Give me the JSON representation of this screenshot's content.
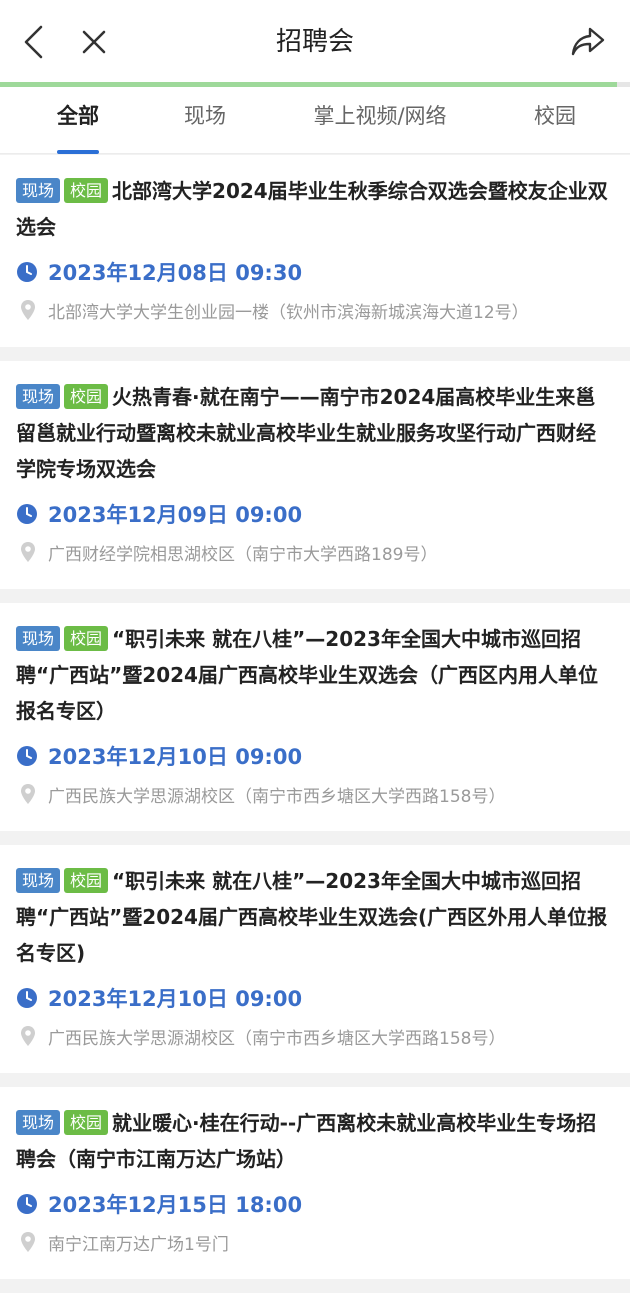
{
  "header": {
    "title": "招聘会"
  },
  "page_load_progress": 0.98,
  "tabs": [
    {
      "label": "全部",
      "active": true
    },
    {
      "label": "现场",
      "active": false
    },
    {
      "label": "掌上视频/网络",
      "active": false
    },
    {
      "label": "校园",
      "active": false
    }
  ],
  "events": [
    {
      "tags": [
        "现场",
        "校园"
      ],
      "title": "北部湾大学2024届毕业生秋季综合双选会暨校友企业双选会",
      "time": "2023年12月08日 09:30",
      "location": "北部湾大学大学生创业园一楼（钦州市滨海新城滨海大道12号）"
    },
    {
      "tags": [
        "现场",
        "校园"
      ],
      "title": "火热青春·就在南宁——南宁市2024届高校毕业生来邕留邕就业行动暨离校未就业高校毕业生就业服务攻坚行动广西财经学院专场双选会",
      "time": "2023年12月09日 09:00",
      "location": "广西财经学院相思湖校区（南宁市大学西路189号）"
    },
    {
      "tags": [
        "现场",
        "校园"
      ],
      "title": "“职引未来 就在八桂”—2023年全国大中城市巡回招聘“广西站”暨2024届广西高校毕业生双选会（广西区内用人单位报名专区）",
      "time": "2023年12月10日 09:00",
      "location": "广西民族大学思源湖校区（南宁市西乡塘区大学西路158号）"
    },
    {
      "tags": [
        "现场",
        "校园"
      ],
      "title": "“职引未来 就在八桂”—2023年全国大中城市巡回招聘“广西站”暨2024届广西高校毕业生双选会(广西区外用人单位报名专区)",
      "time": "2023年12月10日 09:00",
      "location": "广西民族大学思源湖校区（南宁市西乡塘区大学西路158号）"
    },
    {
      "tags": [
        "现场",
        "校园"
      ],
      "title": "就业暖心·桂在行动--广西离校未就业高校毕业生专场招聘会（南宁市江南万达广场站）",
      "time": "2023年12月15日 18:00",
      "location": "南宁江南万达广场1号门"
    }
  ],
  "colors": {
    "accent": "#3a6ec8",
    "tag_onsite": "#4a86c8",
    "tag_campus": "#6cbc46",
    "progress": "#9ed99a"
  },
  "icons": {
    "back": "chevron-left-icon",
    "close": "close-icon",
    "share": "share-icon",
    "time": "clock-icon",
    "location": "location-pin-icon"
  }
}
